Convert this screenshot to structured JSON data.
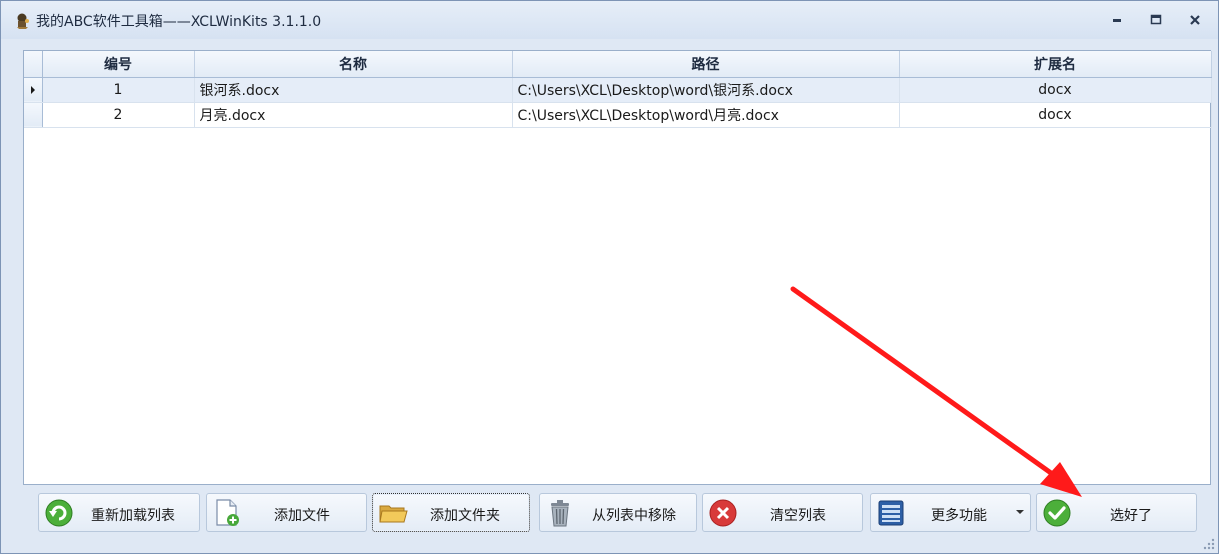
{
  "window": {
    "title": "我的ABC软件工具箱——XCLWinKits  3.1.1.0",
    "icon": "app-icon",
    "controls": [
      "minimize-icon",
      "maximize-icon",
      "close-icon"
    ]
  },
  "grid": {
    "columns": [
      "编号",
      "名称",
      "路径",
      "扩展名"
    ],
    "rows": [
      {
        "id": "1",
        "name": "银河系.docx",
        "path": "C:\\Users\\XCL\\Desktop\\word\\银河系.docx",
        "ext": "docx",
        "selected": true
      },
      {
        "id": "2",
        "name": "月亮.docx",
        "path": "C:\\Users\\XCL\\Desktop\\word\\月亮.docx",
        "ext": "docx",
        "selected": false
      }
    ]
  },
  "toolbar": {
    "reload": {
      "label": "重新加载列表",
      "icon": "reload-icon"
    },
    "add_file": {
      "label": "添加文件",
      "icon": "add-file-icon"
    },
    "add_folder": {
      "label": "添加文件夹",
      "icon": "folder-icon"
    },
    "remove": {
      "label": "从列表中移除",
      "icon": "trash-icon"
    },
    "clear": {
      "label": "清空列表",
      "icon": "clear-icon"
    },
    "more": {
      "label": "更多功能",
      "icon": "more-icon"
    },
    "done": {
      "label": "选好了",
      "icon": "check-icon"
    }
  },
  "colors": {
    "window_bg": "#dfe8f4",
    "selection": "#e5edf8",
    "annotation_arrow": "#ff1a1a"
  }
}
